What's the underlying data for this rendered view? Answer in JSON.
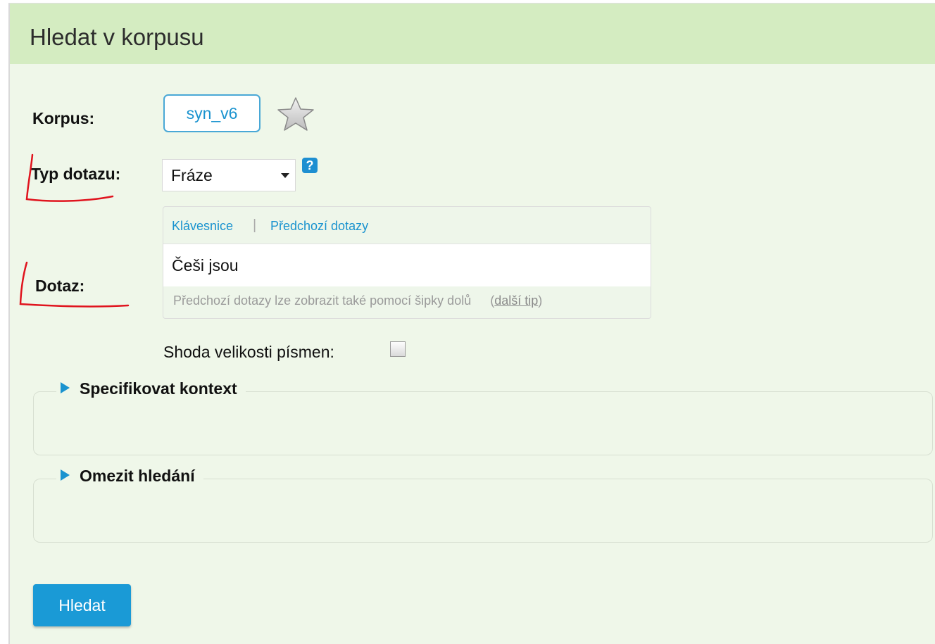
{
  "panel": {
    "title": "Hledat v korpusu"
  },
  "form": {
    "corpus_label": "Korpus:",
    "corpus_value": "syn_v6",
    "query_type_label": "Typ dotazu:",
    "query_type_value": "Fráze",
    "help_icon_text": "?",
    "query_label": "Dotaz:",
    "toolbar": {
      "keyboard": "Klávesnice",
      "separator": "|",
      "history": "Předchozí dotazy"
    },
    "query_value": "Češi jsou",
    "hint_text": "Předchozí dotazy lze zobrazit také pomocí šipky dolů",
    "hint_link": "další tip",
    "case_label": "Shoda velikosti písmen:",
    "case_checked": false
  },
  "sections": [
    {
      "label": "Specifikovat kontext"
    },
    {
      "label": "Omezit hledání"
    }
  ],
  "search_button": "Hledat",
  "colors": {
    "header_bg": "#d4ecc1",
    "panel_bg": "#eff7e9",
    "accent": "#1a93cf",
    "annotation": "#e0141e"
  }
}
